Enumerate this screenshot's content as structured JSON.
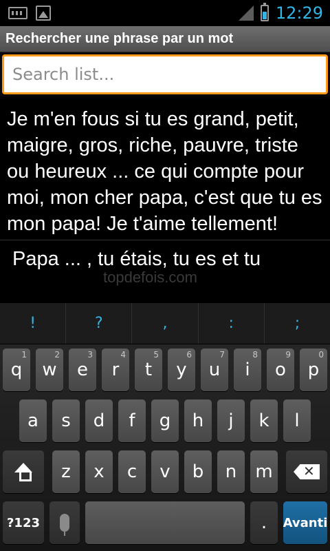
{
  "status_bar": {
    "time": "12:29",
    "icons": [
      "keyboard-icon",
      "image-icon",
      "signal-icon",
      "battery-icon"
    ],
    "accent": "#33b5e5"
  },
  "app": {
    "title": "Rechercher une phrase par un mot"
  },
  "search": {
    "placeholder": "Search list...",
    "value": "",
    "focus_color": "#ff9a1a"
  },
  "list": {
    "items": [
      "Je m'en fous si tu es grand, petit, maigre, gros, riche, pauvre, triste ou heureux ... ce qui compte pour moi, mon cher papa, c'est que tu es mon papa! Je t'aime tellement!",
      "Papa ... , tu étais, tu es et tu"
    ],
    "watermark": "topdefois.com"
  },
  "keyboard": {
    "suggestions": [
      "!",
      "?",
      ",",
      ":",
      ";"
    ],
    "row1": [
      {
        "label": "q",
        "hint": "1"
      },
      {
        "label": "w",
        "hint": "2"
      },
      {
        "label": "e",
        "hint": "3"
      },
      {
        "label": "r",
        "hint": "4"
      },
      {
        "label": "t",
        "hint": "5"
      },
      {
        "label": "y",
        "hint": "6"
      },
      {
        "label": "u",
        "hint": "7"
      },
      {
        "label": "i",
        "hint": "8"
      },
      {
        "label": "o",
        "hint": "9"
      },
      {
        "label": "p",
        "hint": "0"
      }
    ],
    "row2": [
      "a",
      "s",
      "d",
      "f",
      "g",
      "h",
      "j",
      "k",
      "l"
    ],
    "row3": [
      "z",
      "x",
      "c",
      "v",
      "b",
      "n",
      "m"
    ],
    "symbols_label": "?123",
    "period_label": ".",
    "enter_label": "Avanti"
  }
}
